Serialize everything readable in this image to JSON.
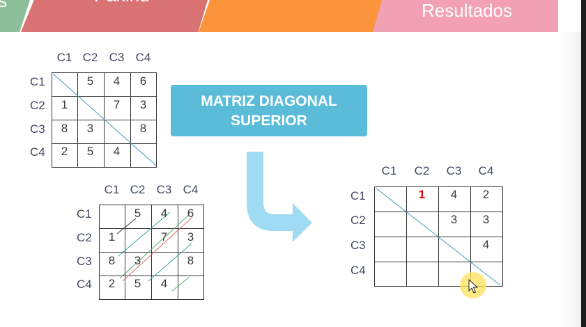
{
  "tabs": [
    {
      "label": "ıs",
      "color": "#8dbf9a"
    },
    {
      "label": "Paxinu",
      "color": "#d97273"
    },
    {
      "label": "",
      "color": "#fb943a"
    },
    {
      "label": "Resultados",
      "color": "#f2a0b3"
    }
  ],
  "title": {
    "line1": "MATRIZ DIAGONAL",
    "line2": "SUPERIOR"
  },
  "matrix_a": {
    "cols": [
      "C1",
      "C2",
      "C3",
      "C4"
    ],
    "rows": [
      "C1",
      "C2",
      "C3",
      "C4"
    ],
    "cells": [
      [
        "",
        "5",
        "4",
        "6"
      ],
      [
        "1",
        "",
        "7",
        "3"
      ],
      [
        "8",
        "3",
        "",
        "8"
      ],
      [
        "2",
        "5",
        "4",
        ""
      ]
    ]
  },
  "matrix_b": {
    "cols": [
      "C1",
      "C2",
      "C3",
      "C4"
    ],
    "rows": [
      "C1",
      "C2",
      "C3",
      "C4"
    ],
    "cells": [
      [
        "",
        "5",
        "4",
        "6"
      ],
      [
        "1",
        "",
        "7",
        "3"
      ],
      [
        "8",
        "3",
        "",
        "8"
      ],
      [
        "2",
        "5",
        "4",
        ""
      ]
    ]
  },
  "matrix_result": {
    "cols": [
      "C1",
      "C2",
      "C3",
      "C4"
    ],
    "rows": [
      "C1",
      "C2",
      "C3",
      "C4"
    ],
    "cells": [
      [
        "",
        "1",
        "4",
        "2"
      ],
      [
        "",
        "",
        "3",
        "3"
      ],
      [
        "",
        "",
        "",
        "4"
      ],
      [
        "",
        "",
        "",
        ""
      ]
    ]
  },
  "colors": {
    "accent_blue": "#5bbcd9",
    "arrow": "#9fdcf3",
    "highlight": "#e00000"
  }
}
